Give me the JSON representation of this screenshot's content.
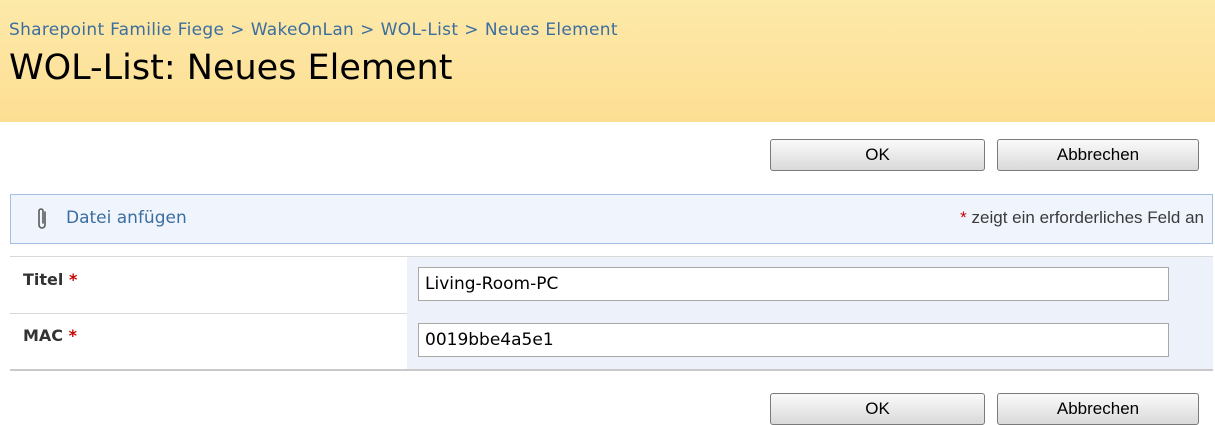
{
  "breadcrumb": {
    "items": [
      "Sharepoint Familie Fiege",
      "WakeOnLan",
      "WOL-List",
      "Neues Element"
    ],
    "separator": ">"
  },
  "page": {
    "title": "WOL-List: Neues Element"
  },
  "buttons": {
    "ok_label": "OK",
    "cancel_label": "Abbrechen"
  },
  "toolbar": {
    "attach_label": "Datei anfügen",
    "attach_icon": "paperclip-icon",
    "required_star": "*",
    "required_note": "zeigt ein erforderliches Feld an"
  },
  "form": {
    "fields": [
      {
        "label": "Titel",
        "required_star": "*",
        "value": "Living-Room-PC"
      },
      {
        "label": "MAC",
        "required_star": "*",
        "value": "0019bbe4a5e1"
      }
    ]
  },
  "colors": {
    "header_bg": "#fde39d",
    "link": "#3b6e9f",
    "required": "#cc0000",
    "toolbar_bg": "#f0f5fd",
    "toolbar_border": "#a6c0e3",
    "field_bg": "#edf2fa"
  }
}
